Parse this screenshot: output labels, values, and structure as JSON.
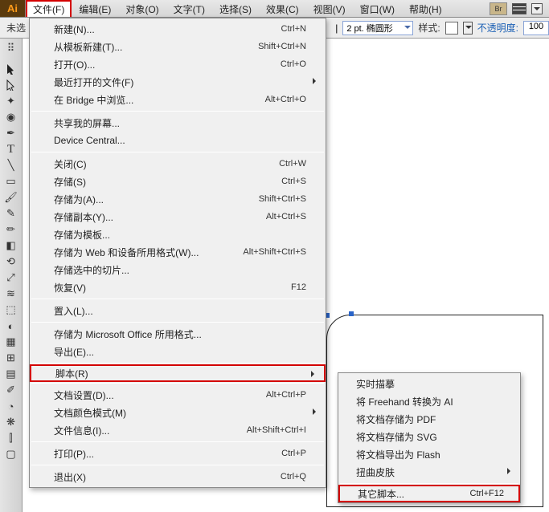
{
  "menubar": {
    "items": [
      "文件(F)",
      "编辑(E)",
      "对象(O)",
      "文字(T)",
      "选择(S)",
      "效果(C)",
      "视图(V)",
      "窗口(W)",
      "帮助(H)"
    ],
    "selected_index": 0,
    "br_label": "Br"
  },
  "toolbar": {
    "status": "未选",
    "divider": "|",
    "stroke_val": "2 pt. 椭圆形",
    "style_label": "样式:",
    "opacity_label": "不透明度:",
    "opacity_val": "100"
  },
  "file_menu": [
    {
      "label": "新建(N)...",
      "shortcut": "Ctrl+N"
    },
    {
      "label": "从模板新建(T)...",
      "shortcut": "Shift+Ctrl+N"
    },
    {
      "label": "打开(O)...",
      "shortcut": "Ctrl+O"
    },
    {
      "label": "最近打开的文件(F)",
      "submenu": true
    },
    {
      "label": "在 Bridge 中浏览...",
      "shortcut": "Alt+Ctrl+O"
    },
    {
      "sep": true
    },
    {
      "label": "共享我的屏幕..."
    },
    {
      "label": "Device Central..."
    },
    {
      "sep": true
    },
    {
      "label": "关闭(C)",
      "shortcut": "Ctrl+W"
    },
    {
      "label": "存储(S)",
      "shortcut": "Ctrl+S"
    },
    {
      "label": "存储为(A)...",
      "shortcut": "Shift+Ctrl+S"
    },
    {
      "label": "存储副本(Y)...",
      "shortcut": "Alt+Ctrl+S"
    },
    {
      "label": "存储为模板..."
    },
    {
      "label": "存储为 Web 和设备所用格式(W)...",
      "shortcut": "Alt+Shift+Ctrl+S"
    },
    {
      "label": "存储选中的切片..."
    },
    {
      "label": "恢复(V)",
      "shortcut": "F12"
    },
    {
      "sep": true
    },
    {
      "label": "置入(L)..."
    },
    {
      "sep": true
    },
    {
      "label": "存储为 Microsoft Office 所用格式..."
    },
    {
      "label": "导出(E)..."
    },
    {
      "sep": true
    },
    {
      "label": "脚本(R)",
      "submenu": true,
      "highlight": true
    },
    {
      "sep": true
    },
    {
      "label": "文档设置(D)...",
      "shortcut": "Alt+Ctrl+P"
    },
    {
      "label": "文档颜色模式(M)",
      "submenu": true
    },
    {
      "label": "文件信息(I)...",
      "shortcut": "Alt+Shift+Ctrl+I"
    },
    {
      "sep": true
    },
    {
      "label": "打印(P)...",
      "shortcut": "Ctrl+P"
    },
    {
      "sep": true
    },
    {
      "label": "退出(X)",
      "shortcut": "Ctrl+Q"
    }
  ],
  "scripts_submenu": [
    {
      "label": "实时描摹"
    },
    {
      "label": "将 Freehand 转换为 AI"
    },
    {
      "label": "将文档存储为 PDF"
    },
    {
      "label": "将文档存储为 SVG"
    },
    {
      "label": "将文档导出为 Flash"
    },
    {
      "label": "扭曲皮肤",
      "submenu": true
    },
    {
      "sep": true
    },
    {
      "label": "其它脚本...",
      "shortcut": "Ctrl+F12",
      "highlight": true
    }
  ]
}
